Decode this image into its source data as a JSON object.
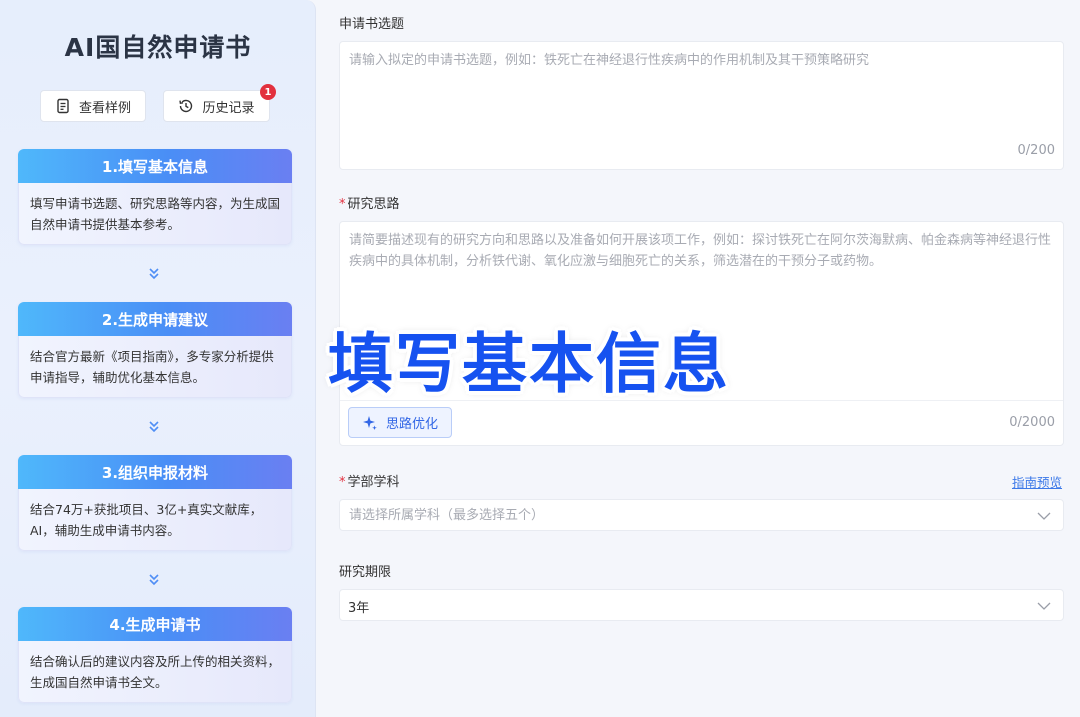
{
  "app": {
    "title": "AI国自然申请书",
    "sample_label": "查看样例",
    "history_label": "历史记录",
    "history_badge": "1"
  },
  "steps": [
    {
      "title": "1.填写基本信息",
      "desc": "填写申请书选题、研究思路等内容，为生成国自然申请书提供基本参考。"
    },
    {
      "title": "2.生成申请建议",
      "desc": "结合官方最新《项目指南》，多专家分析提供申请指导，辅助优化基本信息。"
    },
    {
      "title": "3.组织申报材料",
      "desc": "结合74万+获批项目、3亿+真实文献库，AI，辅助生成申请书内容。"
    },
    {
      "title": "4.生成申请书",
      "desc": "结合确认后的建议内容及所上传的相关资料，生成国自然申请书全文。"
    }
  ],
  "form": {
    "topic": {
      "label": "申请书选题",
      "placeholder": "请输入拟定的申请书选题，例如：铁死亡在神经退行性疾病中的作用机制及其干预策略研究",
      "counter": "0/200"
    },
    "idea": {
      "required_mark": "*",
      "label": "研究思路",
      "placeholder": "请简要描述现有的研究方向和思路以及准备如何开展该项工作，例如：探讨铁死亡在阿尔茨海默病、帕金森病等神经退行性疾病中的具体机制，分析铁代谢、氧化应激与细胞死亡的关系，筛选潜在的干预分子或药物。",
      "optimize_label": "思路优化",
      "counter": "0/2000"
    },
    "discipline": {
      "required_mark": "*",
      "label": "学部学科",
      "guide_link": "指南预览",
      "placeholder": "请选择所属学科（最多选择五个）"
    },
    "period": {
      "label": "研究期限",
      "value": "3年"
    }
  },
  "overlay": {
    "text": "填写基本信息",
    "color": "#1652f0"
  },
  "colors": {
    "accent": "#3c79e8",
    "badge": "#e2303e"
  }
}
